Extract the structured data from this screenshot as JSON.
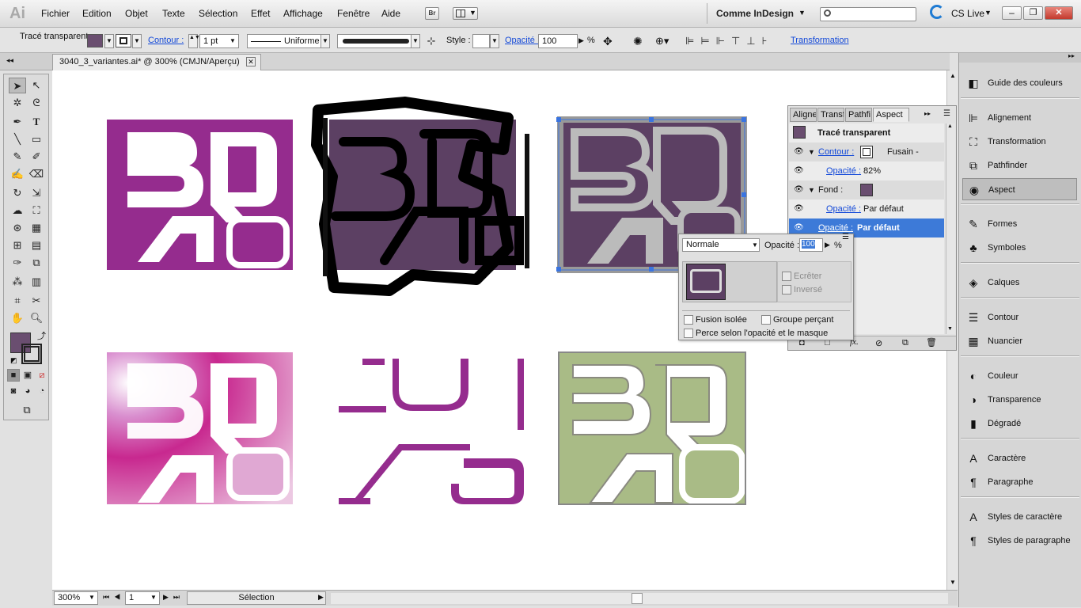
{
  "menu": {
    "app_logo": "Ai",
    "items": [
      "Fichier",
      "Edition",
      "Objet",
      "Texte",
      "Sélection",
      "Effet",
      "Affichage",
      "Fenêtre",
      "Aide"
    ],
    "bridge": "Br",
    "workspace": "Comme InDesign",
    "search_placeholder": "",
    "cslive": "CS Live"
  },
  "control": {
    "selection_label": "Tracé transparent",
    "contour_label": "Contour :",
    "stroke_weight": "1 pt",
    "stroke_profile": "Uniforme",
    "style_label": "Style :",
    "opacity_label": "Opacité :",
    "opacity_value": "100",
    "opacity_unit": "%",
    "transformation": "Transformation"
  },
  "document": {
    "tab_title": "3040_3_variantes.ai* @ 300% (CMJN/Aperçu)"
  },
  "status": {
    "zoom": "300%",
    "page": "1",
    "mode": "Sélection"
  },
  "colors": {
    "purple": "#952c8e",
    "dark_purple": "#5c4063",
    "green": "#a9bb86",
    "fill_swatch": "#6a4e70",
    "selection_blue": "#3a74e0"
  },
  "aspect_panel": {
    "tabs": [
      "Aligne",
      "Transf",
      "Pathfi",
      "Aspect"
    ],
    "title": "Tracé transparent",
    "rows": [
      {
        "label": "Contour :",
        "value": "Fusain - Plume"
      },
      {
        "label": "Opacité :",
        "value": "82%"
      },
      {
        "label": "Fond :",
        "value": ""
      },
      {
        "label": "Opacité :",
        "value": "Par défaut"
      },
      {
        "label": "Opacité :",
        "value": "Par défaut"
      }
    ]
  },
  "transparency_popup": {
    "blend_mode": "Normale",
    "opacity_label": "Opacité :",
    "opacity_value": "100",
    "unit": "%",
    "clip": "Ecrêter",
    "invert": "Inversé",
    "isolate": "Fusion isolée",
    "knockout": "Groupe perçant",
    "knockout_opacity": "Perce selon l'opacité et le masque"
  },
  "dock": {
    "items": [
      "Guide des couleurs",
      "Alignement",
      "Transformation",
      "Pathfinder",
      "Aspect",
      "Formes",
      "Symboles",
      "Calques",
      "Contour",
      "Nuancier",
      "Couleur",
      "Transparence",
      "Dégradé",
      "Caractère",
      "Paragraphe",
      "Styles de caractère",
      "Styles de paragraphe"
    ]
  }
}
